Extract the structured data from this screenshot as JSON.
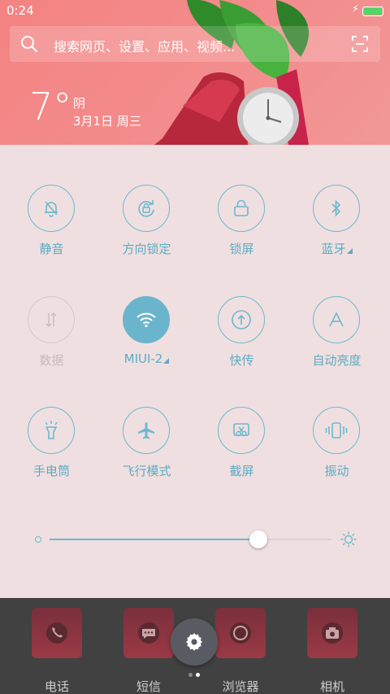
{
  "status": {
    "time": "0:24",
    "charging_icon": "bolt-icon",
    "battery_color": "#4cd964"
  },
  "search": {
    "placeholder": "搜索网页、设置、应用、视频..."
  },
  "weather": {
    "temperature": "7°",
    "condition": "阴",
    "date": "3月1日 周三"
  },
  "toggles": [
    {
      "label": "静音",
      "icon": "bell-off-icon",
      "state": "off"
    },
    {
      "label": "方向锁定",
      "icon": "rotation-lock-icon",
      "state": "off"
    },
    {
      "label": "锁屏",
      "icon": "lock-icon",
      "state": "off"
    },
    {
      "label": "蓝牙",
      "icon": "bluetooth-icon",
      "state": "off"
    },
    {
      "label": "数据",
      "icon": "mobile-data-icon",
      "state": "disabled"
    },
    {
      "label": "MIUI-2",
      "icon": "wifi-icon",
      "state": "on"
    },
    {
      "label": "快传",
      "icon": "share-upload-icon",
      "state": "off"
    },
    {
      "label": "自动亮度",
      "icon": "auto-brightness-icon",
      "state": "off"
    },
    {
      "label": "手电筒",
      "icon": "flashlight-icon",
      "state": "off"
    },
    {
      "label": "飞行模式",
      "icon": "airplane-icon",
      "state": "off"
    },
    {
      "label": "截屏",
      "icon": "screenshot-icon",
      "state": "off"
    },
    {
      "label": "振动",
      "icon": "vibrate-icon",
      "state": "off"
    }
  ],
  "brightness": {
    "level": 0.74,
    "accent": "#6bb9cf"
  },
  "dock": [
    {
      "label": "电话",
      "icon": "phone-icon"
    },
    {
      "label": "短信",
      "icon": "message-icon"
    },
    {
      "label": "浏览器",
      "icon": "browser-icon"
    },
    {
      "label": "相机",
      "icon": "camera-icon"
    }
  ],
  "pager": {
    "pages": 2,
    "current": 1
  }
}
